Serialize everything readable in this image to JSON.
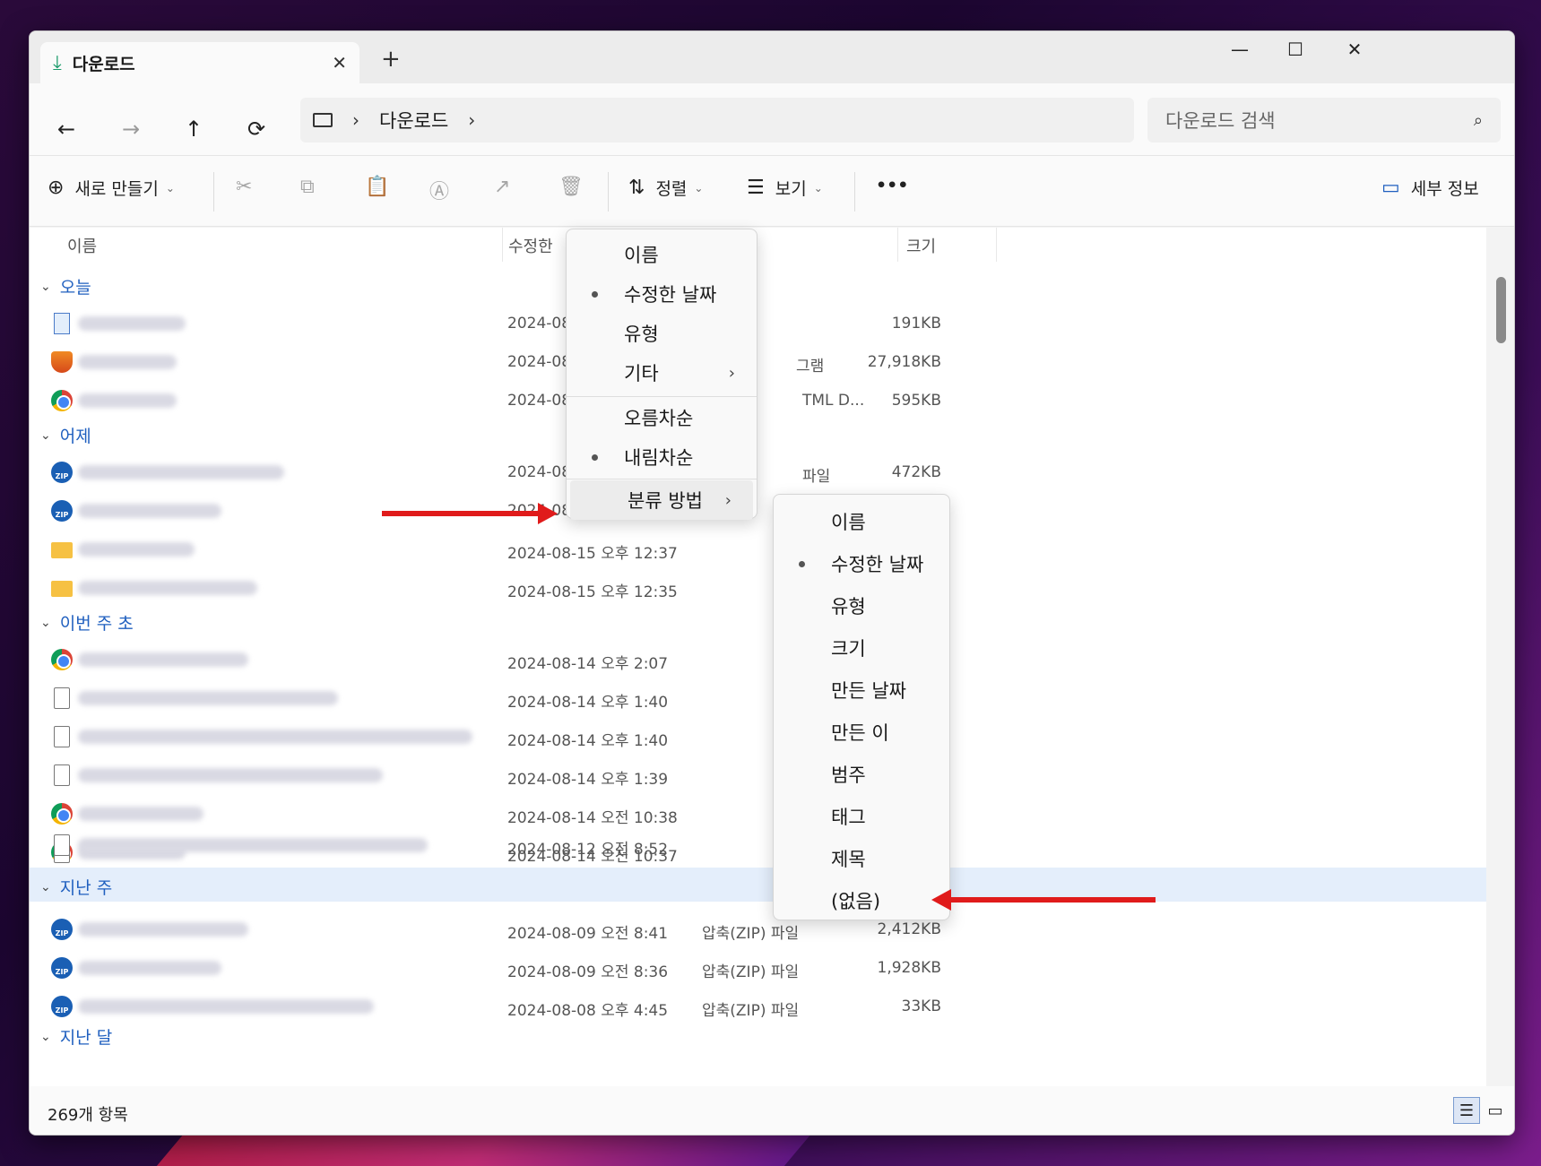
{
  "tab": {
    "title": "다운로드",
    "close": "✕",
    "new_tab": "+"
  },
  "window_controls": {
    "minimize": "—",
    "maximize": "☐",
    "close": "✕"
  },
  "nav": {
    "back": "←",
    "forward": "→",
    "up": "↑",
    "refresh": "⟳"
  },
  "address": {
    "folder": "다운로드",
    "separator": "›"
  },
  "search": {
    "placeholder": "다운로드 검색"
  },
  "toolbar": {
    "new": "새로 만들기",
    "sort": "정렬",
    "view": "보기",
    "more": "•••",
    "details": "세부 정보"
  },
  "columns": {
    "name": "이름",
    "modified": "수정한",
    "size": "크기"
  },
  "groups": [
    {
      "label": "오늘"
    },
    {
      "label": "어제"
    },
    {
      "label": "이번 주 초"
    },
    {
      "label": "지난 주"
    },
    {
      "label": "지난 달"
    }
  ],
  "rows": [
    {
      "icon": "image-file-icon",
      "date": "2024-08",
      "type": "",
      "size": "191KB"
    },
    {
      "icon": "installer-icon",
      "date": "2024-08",
      "type": "그램",
      "size": "27,918KB"
    },
    {
      "icon": "chrome-icon",
      "date": "2024-08",
      "type": "TML D...",
      "size": "595KB"
    },
    {
      "icon": "zip-icon",
      "date": "2024-08",
      "type": "파일",
      "size": "472KB"
    },
    {
      "icon": "zip-icon",
      "date": "2024-08",
      "type": "",
      "size": ""
    },
    {
      "icon": "folder-icon",
      "date": "2024-08-15 오후 12:37",
      "type": "",
      "size": ""
    },
    {
      "icon": "folder-icon",
      "date": "2024-08-15 오후 12:35",
      "type": "",
      "size": ""
    },
    {
      "icon": "chrome-icon",
      "date": "2024-08-14 오후 2:07",
      "type": "",
      "size": ""
    },
    {
      "icon": "document-icon",
      "date": "2024-08-14 오후 1:40",
      "type": "",
      "size": ""
    },
    {
      "icon": "document-icon",
      "date": "2024-08-14 오후 1:40",
      "type": "",
      "size": ""
    },
    {
      "icon": "document-icon",
      "date": "2024-08-14 오후 1:39",
      "type": "",
      "size": ""
    },
    {
      "icon": "chrome-icon",
      "date": "2024-08-14 오전 10:38",
      "type": "",
      "size": ""
    },
    {
      "icon": "chrome-icon",
      "date": "2024-08-14 오전 10:37",
      "type": "",
      "size": ""
    },
    {
      "icon": "document-icon",
      "date": "2024-08-12 오전 8:52",
      "type": "",
      "size": ""
    },
    {
      "icon": "zip-icon",
      "date": "2024-08-09 오전 8:41",
      "type": "압축(ZIP) 파일",
      "size": "2,412KB"
    },
    {
      "icon": "zip-icon",
      "date": "2024-08-09 오전 8:36",
      "type": "압축(ZIP) 파일",
      "size": "1,928KB"
    },
    {
      "icon": "zip-icon",
      "date": "2024-08-08 오후 4:45",
      "type": "압축(ZIP) 파일",
      "size": "33KB"
    }
  ],
  "sort_menu": {
    "items": [
      "이름",
      "수정한 날짜",
      "유형",
      "기타"
    ],
    "order": [
      "오름차순",
      "내림차순"
    ],
    "group_by": "분류 방법"
  },
  "group_menu": {
    "items": [
      "이름",
      "수정한 날짜",
      "유형",
      "크기",
      "만든 날짜",
      "만든 이",
      "범주",
      "태그",
      "제목",
      "(없음)"
    ]
  },
  "status": {
    "count": "269개 항목"
  },
  "colors": {
    "accent": "#1f5fbf",
    "arrow": "#e01b1b",
    "highlight": "#e4eefb"
  }
}
